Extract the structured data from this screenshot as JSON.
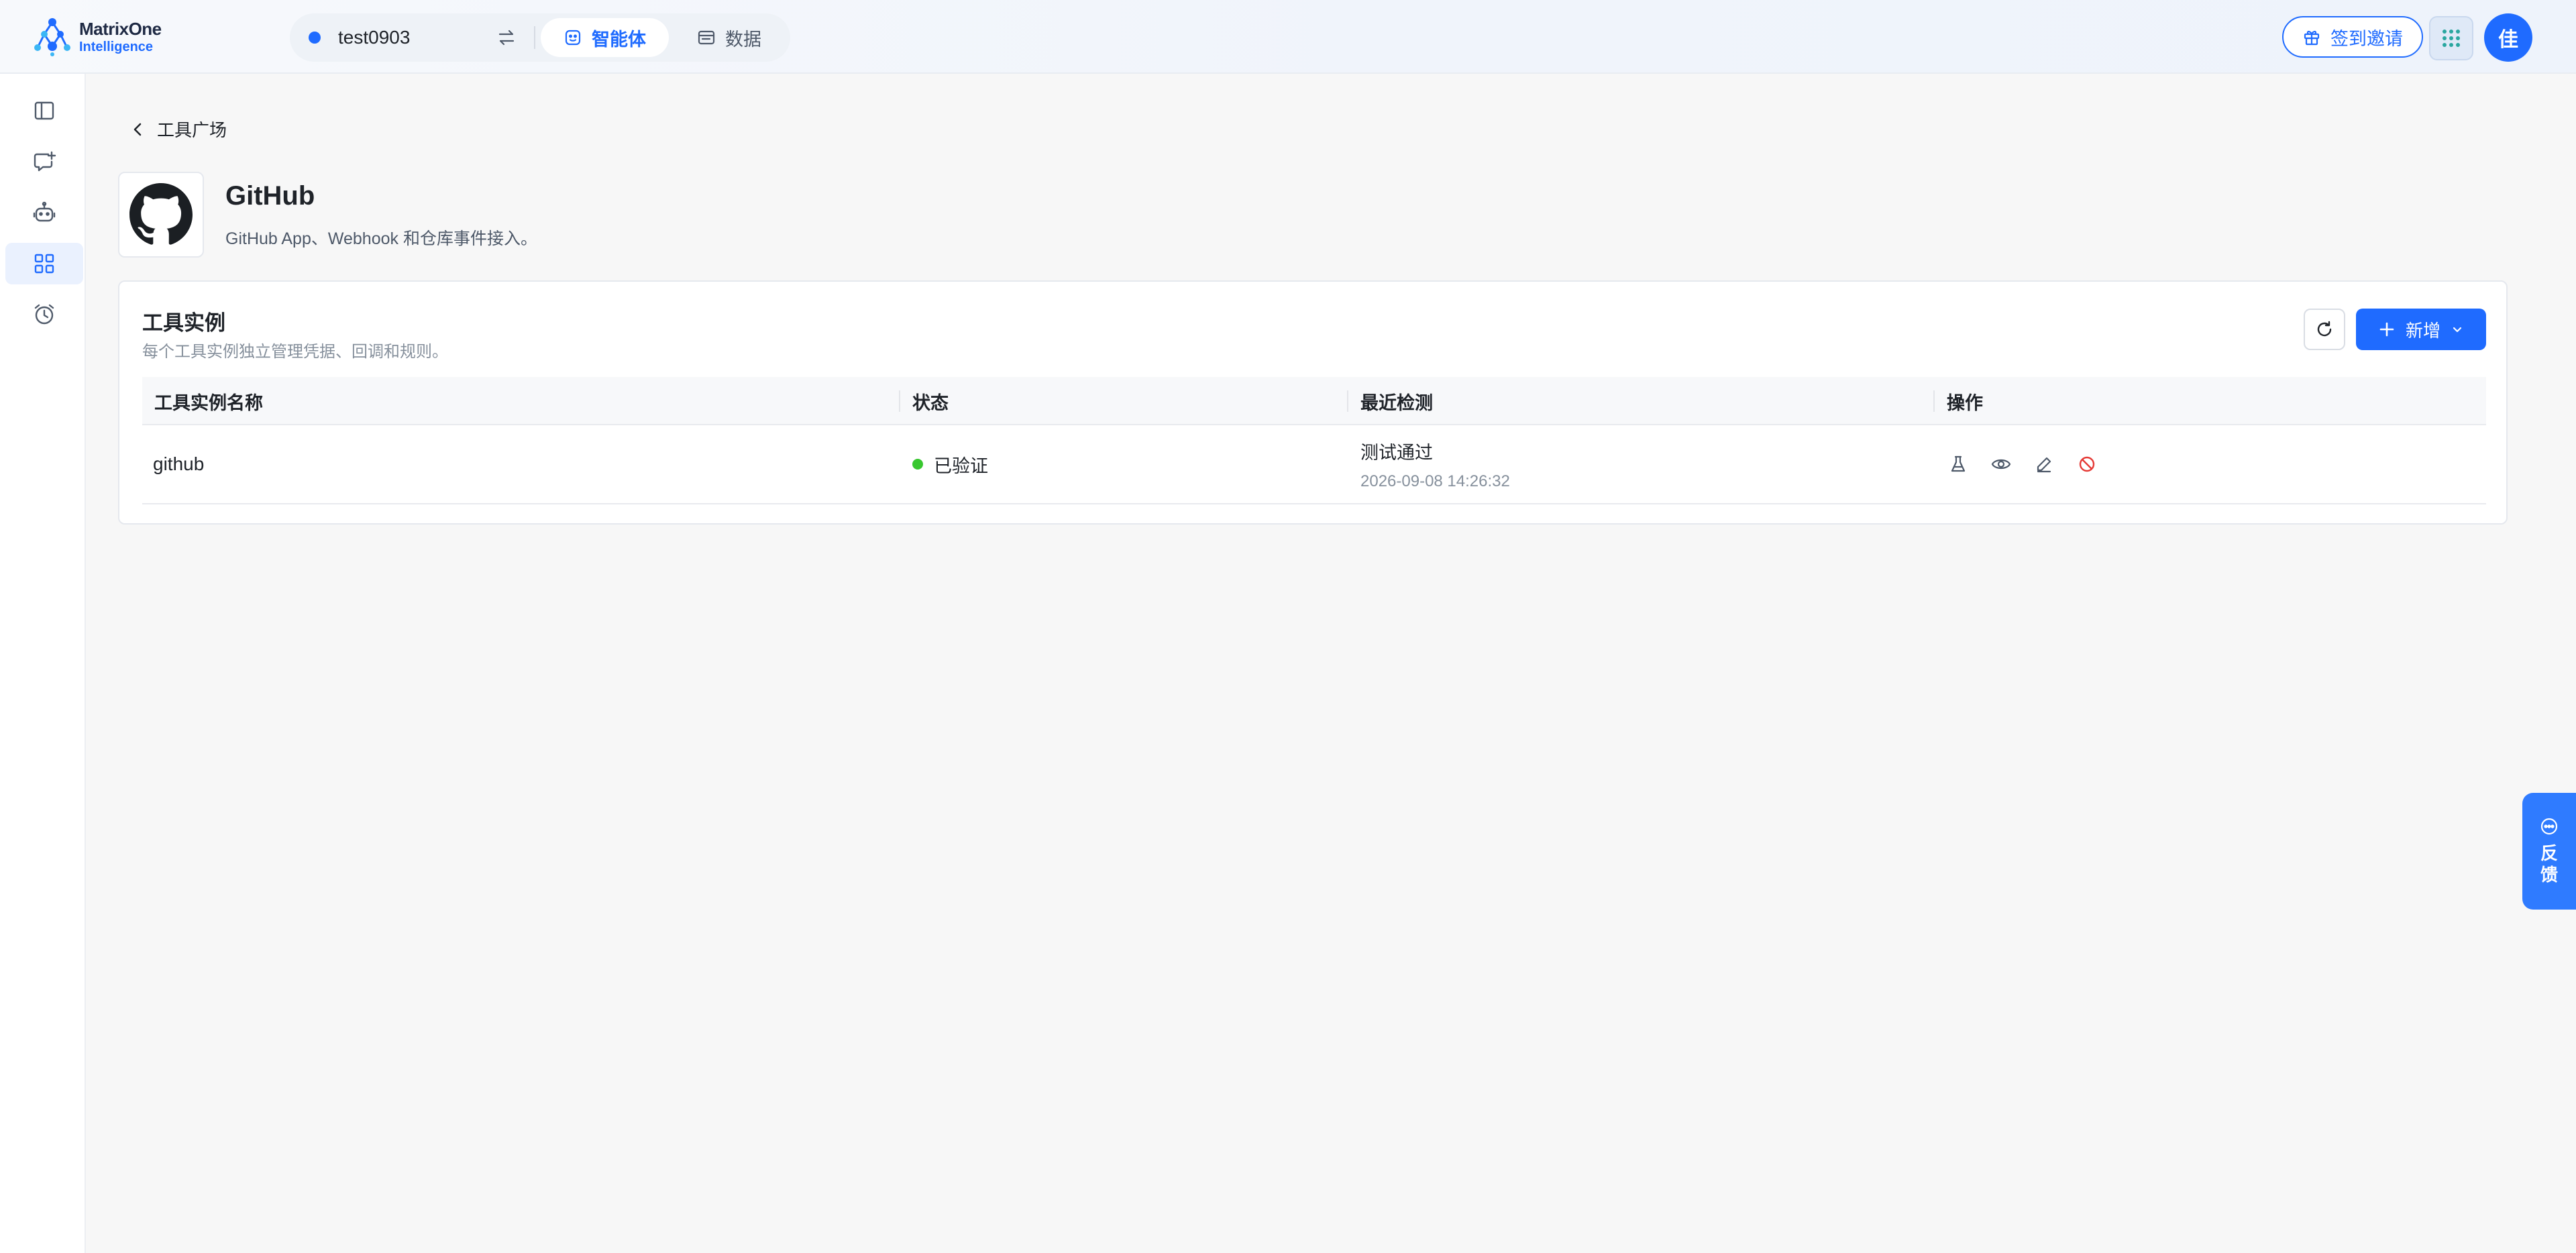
{
  "app": {
    "brand_name": "MatrixOne",
    "brand_sub": "Intelligence"
  },
  "topbar": {
    "workspace_name": "test0903",
    "tabs": [
      {
        "label": "智能体",
        "icon": "agent-icon",
        "active": true
      },
      {
        "label": "数据",
        "icon": "data-icon",
        "active": false
      }
    ],
    "invite_label": "签到邀请",
    "avatar_text": "佳",
    "accent_color": "#1f6bff"
  },
  "sidebar": {
    "items": [
      {
        "icon": "sidebar-toggle-icon",
        "active": false
      },
      {
        "icon": "new-chat-icon",
        "active": false
      },
      {
        "icon": "robot-icon",
        "active": false
      },
      {
        "icon": "grid-icon",
        "active": true
      },
      {
        "icon": "alarm-clock-icon",
        "active": false
      }
    ]
  },
  "breadcrumb": {
    "back_label": "工具广场"
  },
  "tool": {
    "name": "GitHub",
    "description": "GitHub App、Webhook 和仓库事件接入。",
    "logo_icon": "github-icon"
  },
  "instances": {
    "title": "工具实例",
    "subtitle": "每个工具实例独立管理凭据、回调和规则。",
    "add_label": "新增",
    "columns": [
      "工具实例名称",
      "状态",
      "最近检测",
      "操作"
    ],
    "rows": [
      {
        "name": "github",
        "status": "已验证",
        "status_color": "#38c72f",
        "check_result": "测试通过",
        "check_time": "2026-09-08 14:26:32",
        "actions": [
          "test-flask-icon",
          "view-eye-icon",
          "edit-pencil-icon",
          "disable-icon"
        ]
      }
    ]
  },
  "feedback": {
    "label": "反馈"
  }
}
